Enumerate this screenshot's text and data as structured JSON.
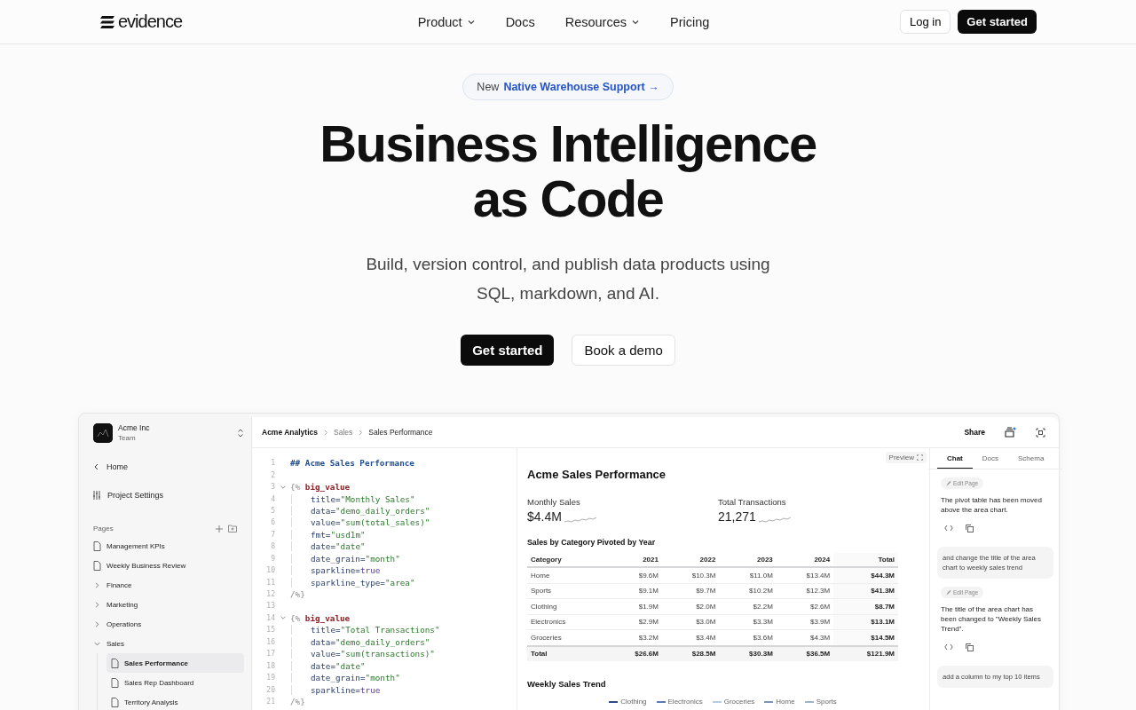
{
  "header": {
    "logo": "evidence",
    "nav": [
      {
        "label": "Product",
        "dropdown": true
      },
      {
        "label": "Docs",
        "dropdown": false
      },
      {
        "label": "Resources",
        "dropdown": true
      },
      {
        "label": "Pricing",
        "dropdown": false
      }
    ],
    "login": "Log in",
    "cta": "Get started"
  },
  "hero": {
    "badge_tag": "New",
    "badge_link": "Native Warehouse Support →",
    "title_lines": [
      "Business Intelligence",
      "as Code"
    ],
    "subtitle_lines": [
      "Build, version control, and publish data products using",
      "SQL, markdown, and AI."
    ],
    "primary": "Get started",
    "secondary": "Book a demo"
  },
  "app": {
    "org": {
      "name": "Acme Inc",
      "team": "Team"
    },
    "sidebar": {
      "home": "Home",
      "settings": "Project Settings",
      "pages_label": "Pages",
      "pages": [
        {
          "kind": "page",
          "label": "Management KPIs",
          "selected": false
        },
        {
          "kind": "page",
          "label": "Weekly Business Review",
          "selected": false
        },
        {
          "kind": "folder",
          "label": "Finance",
          "expanded": false,
          "selected": false
        },
        {
          "kind": "folder",
          "label": "Marketing",
          "expanded": false,
          "selected": false
        },
        {
          "kind": "folder",
          "label": "Operations",
          "expanded": false,
          "selected": false
        },
        {
          "kind": "folder",
          "label": "Sales",
          "expanded": true,
          "selected": false,
          "children": [
            {
              "kind": "page",
              "label": "Sales Performance",
              "selected": true
            },
            {
              "kind": "page",
              "label": "Sales Rep Dashboard",
              "selected": false
            },
            {
              "kind": "page",
              "label": "Territory Analysis",
              "selected": false
            }
          ]
        }
      ]
    },
    "breadcrumbs": [
      "Acme Analytics",
      "Sales",
      "Sales Performance"
    ],
    "share": "Share",
    "code": [
      {
        "n": "1",
        "tokens": [
          {
            "kind": "heading",
            "text": "## Acme Sales Performance"
          }
        ]
      },
      {
        "n": "2"
      },
      {
        "n": "3",
        "expanded": true,
        "tokens": [
          {
            "kind": "punct",
            "text": "{% "
          },
          {
            "kind": "keyword",
            "text": "big_value"
          }
        ]
      },
      {
        "n": "4",
        "indent": true,
        "tokens": [
          {
            "kind": "attr",
            "text": "title="
          },
          {
            "kind": "string",
            "text": "\"Monthly Sales\""
          }
        ]
      },
      {
        "n": "5",
        "indent": true,
        "tokens": [
          {
            "kind": "attr",
            "text": "data="
          },
          {
            "kind": "string",
            "text": "\"demo_daily_orders\""
          }
        ]
      },
      {
        "n": "6",
        "indent": true,
        "tokens": [
          {
            "kind": "attr",
            "text": "value="
          },
          {
            "kind": "string",
            "text": "\"sum(total_sales)\""
          }
        ]
      },
      {
        "n": "7",
        "indent": true,
        "tokens": [
          {
            "kind": "attr",
            "text": "fmt="
          },
          {
            "kind": "string",
            "text": "\"usd1m\""
          }
        ]
      },
      {
        "n": "8",
        "indent": true,
        "tokens": [
          {
            "kind": "attr",
            "text": "date="
          },
          {
            "kind": "string",
            "text": "\"date\""
          }
        ]
      },
      {
        "n": "9",
        "indent": true,
        "tokens": [
          {
            "kind": "attr",
            "text": "date_grain="
          },
          {
            "kind": "string",
            "text": "\"month\""
          }
        ]
      },
      {
        "n": "10",
        "indent": true,
        "tokens": [
          {
            "kind": "attr",
            "text": "sparkline="
          },
          {
            "kind": "literal",
            "text": "true"
          }
        ]
      },
      {
        "n": "11",
        "indent": true,
        "tokens": [
          {
            "kind": "attr",
            "text": "sparkline_type="
          },
          {
            "kind": "string",
            "text": "\"area\""
          }
        ]
      },
      {
        "n": "12",
        "tokens": [
          {
            "kind": "punct",
            "text": "/%}"
          }
        ]
      },
      {
        "n": "13"
      },
      {
        "n": "14",
        "expanded": true,
        "tokens": [
          {
            "kind": "punct",
            "text": "{% "
          },
          {
            "kind": "keyword",
            "text": "big_value"
          }
        ]
      },
      {
        "n": "15",
        "indent": true,
        "tokens": [
          {
            "kind": "attr",
            "text": "title="
          },
          {
            "kind": "string",
            "text": "\"Total Transactions\""
          }
        ]
      },
      {
        "n": "16",
        "indent": true,
        "tokens": [
          {
            "kind": "attr",
            "text": "data="
          },
          {
            "kind": "string",
            "text": "\"demo_daily_orders\""
          }
        ]
      },
      {
        "n": "17",
        "indent": true,
        "tokens": [
          {
            "kind": "attr",
            "text": "value="
          },
          {
            "kind": "string",
            "text": "\"sum(transactions)\""
          }
        ]
      },
      {
        "n": "18",
        "indent": true,
        "tokens": [
          {
            "kind": "attr",
            "text": "date="
          },
          {
            "kind": "string",
            "text": "\"date\""
          }
        ]
      },
      {
        "n": "19",
        "indent": true,
        "tokens": [
          {
            "kind": "attr",
            "text": "date_grain="
          },
          {
            "kind": "string",
            "text": "\"month\""
          }
        ]
      },
      {
        "n": "20",
        "indent": true,
        "tokens": [
          {
            "kind": "attr",
            "text": "sparkline="
          },
          {
            "kind": "literal",
            "text": "true"
          }
        ]
      },
      {
        "n": "21",
        "tokens": [
          {
            "kind": "punct",
            "text": "/%}"
          }
        ]
      }
    ],
    "preview": {
      "button": "Preview",
      "title": "Acme Sales Performance",
      "metrics": [
        {
          "label": "Monthly Sales",
          "value": "$4.4M"
        },
        {
          "label": "Total Transactions",
          "value": "21,271"
        }
      ],
      "table_title": "Sales by Category Pivoted by Year",
      "table": {
        "columns": [
          "Category",
          "2021",
          "2022",
          "2023",
          "2024",
          "Total"
        ],
        "rows": [
          [
            "Home",
            "$9.6M",
            "$10.3M",
            "$11.0M",
            "$13.4M",
            "$44.3M"
          ],
          [
            "Sports",
            "$9.1M",
            "$9.7M",
            "$10.2M",
            "$12.3M",
            "$41.3M"
          ],
          [
            "Clothing",
            "$1.9M",
            "$2.0M",
            "$2.2M",
            "$2.6M",
            "$8.7M"
          ],
          [
            "Electronics",
            "$2.9M",
            "$3.0M",
            "$3.3M",
            "$3.9M",
            "$13.1M"
          ],
          [
            "Groceries",
            "$3.2M",
            "$3.4M",
            "$3.6M",
            "$4.3M",
            "$14.5M"
          ]
        ],
        "total": [
          "Total",
          "$26.6M",
          "$28.5M",
          "$30.3M",
          "$36.5M",
          "$121.9M"
        ]
      },
      "chart_title": "Weekly Sales Trend",
      "legend": [
        {
          "label": "Clothing",
          "color": "#2f4a8a"
        },
        {
          "label": "Electronics",
          "color": "#5a7bb5"
        },
        {
          "label": "Groceries",
          "color": "#b9cde0"
        },
        {
          "label": "Home",
          "color": "#7d93b8"
        },
        {
          "label": "Sports",
          "color": "#9fb4c8"
        }
      ]
    },
    "chat": {
      "tabs": [
        {
          "label": "Chat",
          "selected": true
        },
        {
          "label": "Docs",
          "selected": false
        },
        {
          "label": "Schema",
          "selected": false
        }
      ],
      "messages": [
        {
          "kind": "assistant",
          "badge": "Edit Page",
          "text": "The pivot table has been moved above the area chart."
        },
        {
          "kind": "user",
          "text": "and change the title of the area chart to weekly sales trend"
        },
        {
          "kind": "assistant",
          "badge": "Edit Page",
          "text": "The title of the area chart has been changed to \"Weekly Sales Trend\"."
        },
        {
          "kind": "user",
          "text": "add a column to my top 10 items"
        }
      ]
    }
  }
}
